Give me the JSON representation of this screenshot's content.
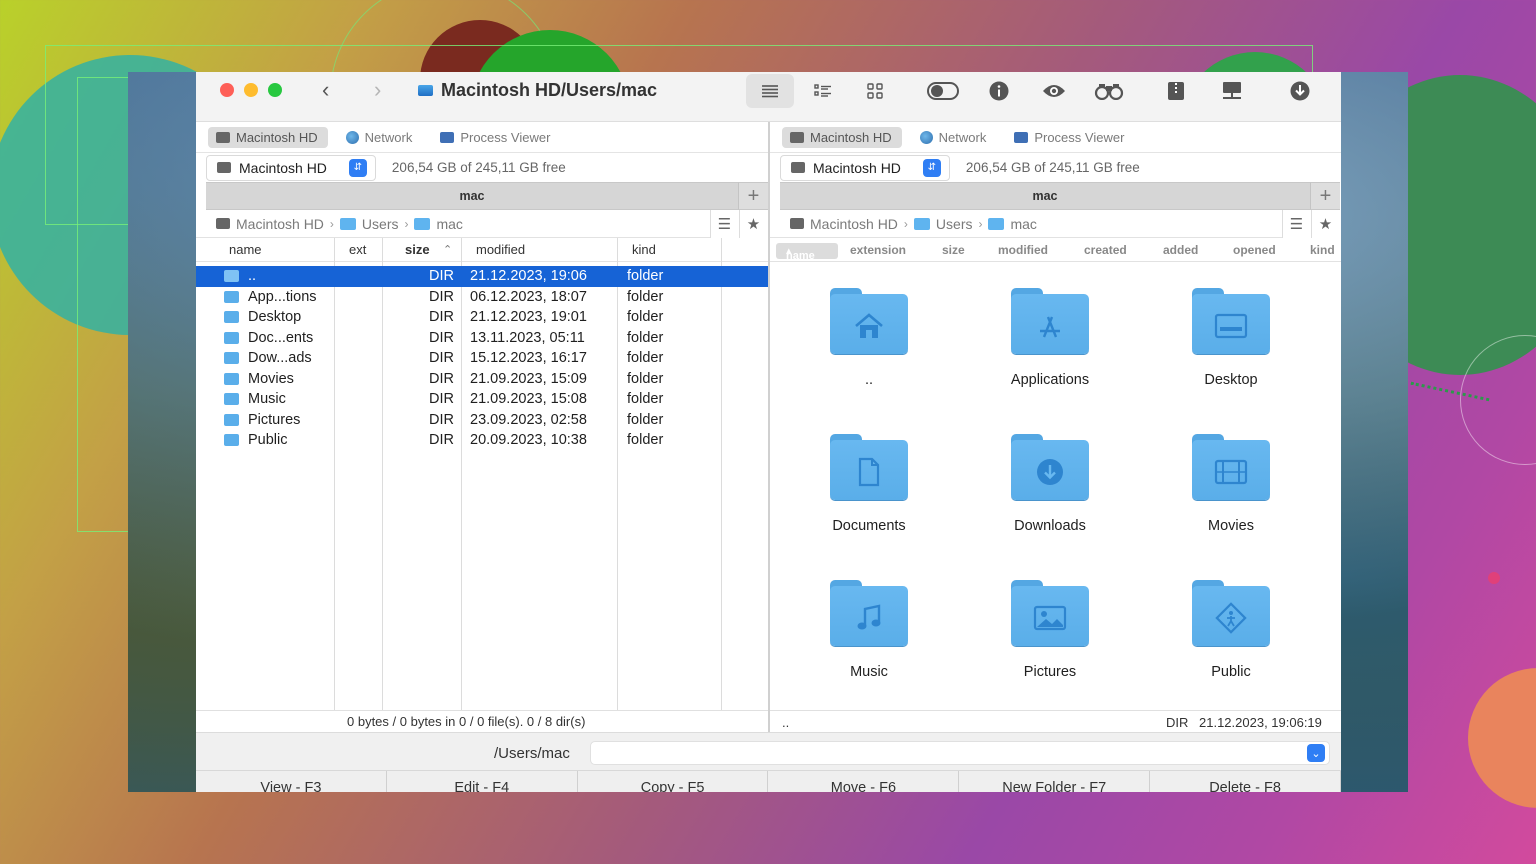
{
  "window": {
    "path_title": "Macintosh HD/Users/mac"
  },
  "toolbar": {
    "icons": [
      "list-view-icon",
      "detailed-list-icon",
      "grid-view-icon",
      "toggle-icon",
      "info-icon",
      "eye-icon",
      "binoculars-icon",
      "archive-icon",
      "network-drive-icon",
      "download-icon"
    ]
  },
  "left": {
    "tabs": [
      "Macintosh HD",
      "Network",
      "Process Viewer"
    ],
    "drive": "Macintosh HD",
    "free": "206,54 GB of 245,11 GB free",
    "panel_title": "mac",
    "breadcrumb": [
      "Macintosh HD",
      "Users",
      "mac"
    ],
    "columns": {
      "name": "name",
      "ext": "ext",
      "size": "size",
      "modified": "modified",
      "kind": "kind"
    },
    "rows": [
      {
        "name": "..",
        "size": "DIR",
        "modified": "21.12.2023, 19:06",
        "kind": "folder"
      },
      {
        "name": "App...tions",
        "size": "DIR",
        "modified": "06.12.2023, 18:07",
        "kind": "folder"
      },
      {
        "name": "Desktop",
        "size": "DIR",
        "modified": "21.12.2023, 19:01",
        "kind": "folder"
      },
      {
        "name": "Doc...ents",
        "size": "DIR",
        "modified": "13.11.2023, 05:11",
        "kind": "folder"
      },
      {
        "name": "Dow...ads",
        "size": "DIR",
        "modified": "15.12.2023, 16:17",
        "kind": "folder"
      },
      {
        "name": "Movies",
        "size": "DIR",
        "modified": "21.09.2023, 15:09",
        "kind": "folder"
      },
      {
        "name": "Music",
        "size": "DIR",
        "modified": "21.09.2023, 15:08",
        "kind": "folder"
      },
      {
        "name": "Pictures",
        "size": "DIR",
        "modified": "23.09.2023, 02:58",
        "kind": "folder"
      },
      {
        "name": "Public",
        "size": "DIR",
        "modified": "20.09.2023, 10:38",
        "kind": "folder"
      }
    ],
    "status": "0 bytes / 0 bytes in 0 / 0 file(s). 0 / 8 dir(s)"
  },
  "right": {
    "tabs": [
      "Macintosh HD",
      "Network",
      "Process Viewer"
    ],
    "drive": "Macintosh HD",
    "free": "206,54 GB of 245,11 GB free",
    "panel_title": "mac",
    "breadcrumb": [
      "Macintosh HD",
      "Users",
      "mac"
    ],
    "columns": {
      "name": "name",
      "extension": "extension",
      "size": "size",
      "modified": "modified",
      "created": "created",
      "added": "added",
      "opened": "opened",
      "kind": "kind"
    },
    "items": [
      {
        "label": "..",
        "icon": "home-folder-icon"
      },
      {
        "label": "Applications",
        "icon": "applications-folder-icon"
      },
      {
        "label": "Desktop",
        "icon": "desktop-folder-icon"
      },
      {
        "label": "Documents",
        "icon": "documents-folder-icon"
      },
      {
        "label": "Downloads",
        "icon": "downloads-folder-icon"
      },
      {
        "label": "Movies",
        "icon": "movies-folder-icon"
      },
      {
        "label": "Music",
        "icon": "music-folder-icon"
      },
      {
        "label": "Pictures",
        "icon": "pictures-folder-icon"
      },
      {
        "label": "Public",
        "icon": "public-folder-icon"
      }
    ],
    "status_left": "..",
    "status_kind": "DIR",
    "status_date": "21.12.2023, 19:06:19"
  },
  "command": {
    "path_label": "/Users/mac",
    "value": ""
  },
  "fkeys": [
    "View - F3",
    "Edit - F4",
    "Copy - F5",
    "Move - F6",
    "New Folder - F7",
    "Delete - F8"
  ],
  "colors": {
    "selection": "#1663d6",
    "accent": "#2f7ef4",
    "folder": "#5aaee9"
  }
}
